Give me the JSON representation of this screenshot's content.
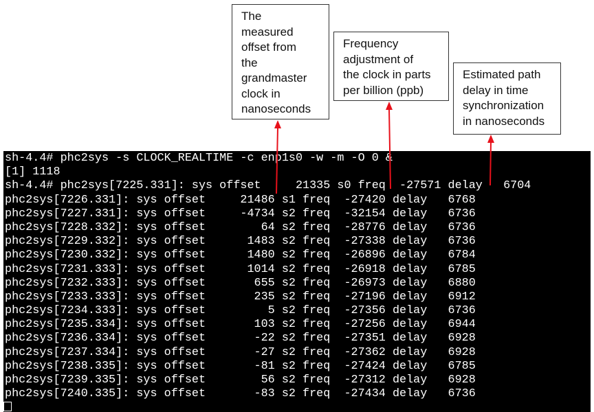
{
  "callouts": [
    {
      "lines": [
        "The",
        "measured",
        "offset from",
        "the",
        "grandmaster",
        "clock in",
        "nanoseconds"
      ]
    },
    {
      "lines": [
        "Frequency",
        "adjustment of",
        "the clock in parts",
        "per billion (ppb)"
      ]
    },
    {
      "lines": [
        "Estimated path",
        "delay in time",
        "synchronization",
        "in nanoseconds"
      ]
    }
  ],
  "terminal": {
    "lines": [
      "sh-4.4# phc2sys -s CLOCK_REALTIME -c enp1s0 -w -m -O 0 &",
      "[1] 1118",
      "sh-4.4# phc2sys[7225.331]: sys offset     21335 s0 freq  -27571 delay   6704",
      "phc2sys[7226.331]: sys offset     21486 s1 freq  -27420 delay   6768",
      "phc2sys[7227.331]: sys offset     -4734 s2 freq  -32154 delay   6736",
      "phc2sys[7228.332]: sys offset        64 s2 freq  -28776 delay   6736",
      "phc2sys[7229.332]: sys offset      1483 s2 freq  -27338 delay   6736",
      "phc2sys[7230.332]: sys offset      1480 s2 freq  -26896 delay   6784",
      "phc2sys[7231.333]: sys offset      1014 s2 freq  -26918 delay   6785",
      "phc2sys[7232.333]: sys offset       655 s2 freq  -26973 delay   6880",
      "phc2sys[7233.333]: sys offset       235 s2 freq  -27196 delay   6912",
      "phc2sys[7234.333]: sys offset         5 s2 freq  -27356 delay   6736",
      "phc2sys[7235.334]: sys offset       103 s2 freq  -27256 delay   6944",
      "phc2sys[7236.334]: sys offset       -22 s2 freq  -27351 delay   6928",
      "phc2sys[7237.334]: sys offset       -27 s2 freq  -27362 delay   6928",
      "phc2sys[7238.335]: sys offset       -81 s2 freq  -27424 delay   6785",
      "phc2sys[7239.335]: sys offset        56 s2 freq  -27312 delay   6928",
      "phc2sys[7240.335]: sys offset       -83 s2 freq  -27434 delay   6736"
    ]
  },
  "colors": {
    "terminal_bg": "#000000",
    "terminal_fg": "#ffffff",
    "arrow": "#e8111b",
    "callout_border": "#333333"
  }
}
